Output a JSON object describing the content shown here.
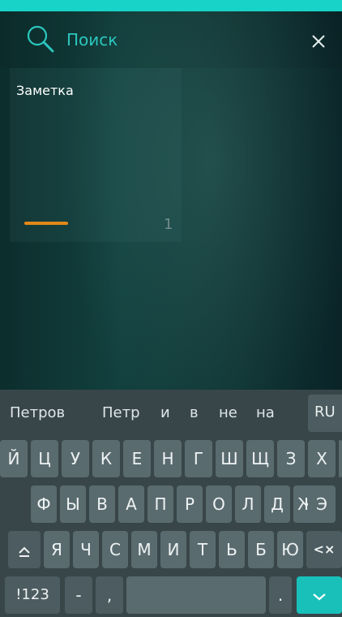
{
  "search": {
    "placeholder": "Поиск"
  },
  "note": {
    "title": "Заметка",
    "count": "1"
  },
  "keyboard": {
    "suggestions": [
      "Петров",
      "Петр",
      "и",
      "в",
      "не",
      "на"
    ],
    "language": "RU",
    "rows": [
      [
        "Й",
        "Ц",
        "У",
        "К",
        "Е",
        "Н",
        "Г",
        "Ш",
        "Щ",
        "З",
        "Х",
        "Ъ"
      ],
      [
        "Ф",
        "Ы",
        "В",
        "А",
        "П",
        "Р",
        "О",
        "Л",
        "Д",
        "Ж",
        "Э"
      ],
      [
        "Я",
        "Ч",
        "С",
        "М",
        "И",
        "Т",
        "Ь",
        "Б",
        "Ю"
      ]
    ],
    "numbers_label": "!123",
    "dash": "-",
    "comma": ",",
    "period": ".",
    "backspace_label": "<×"
  },
  "colors": {
    "accent": "#18d3c8",
    "search_text": "#2bc7be",
    "note_bar": "#e2881a",
    "enter_key": "#19c0ba"
  },
  "icons": [
    "search-icon",
    "close-icon",
    "shift-icon",
    "backspace-icon",
    "enter-chevron-icon"
  ]
}
